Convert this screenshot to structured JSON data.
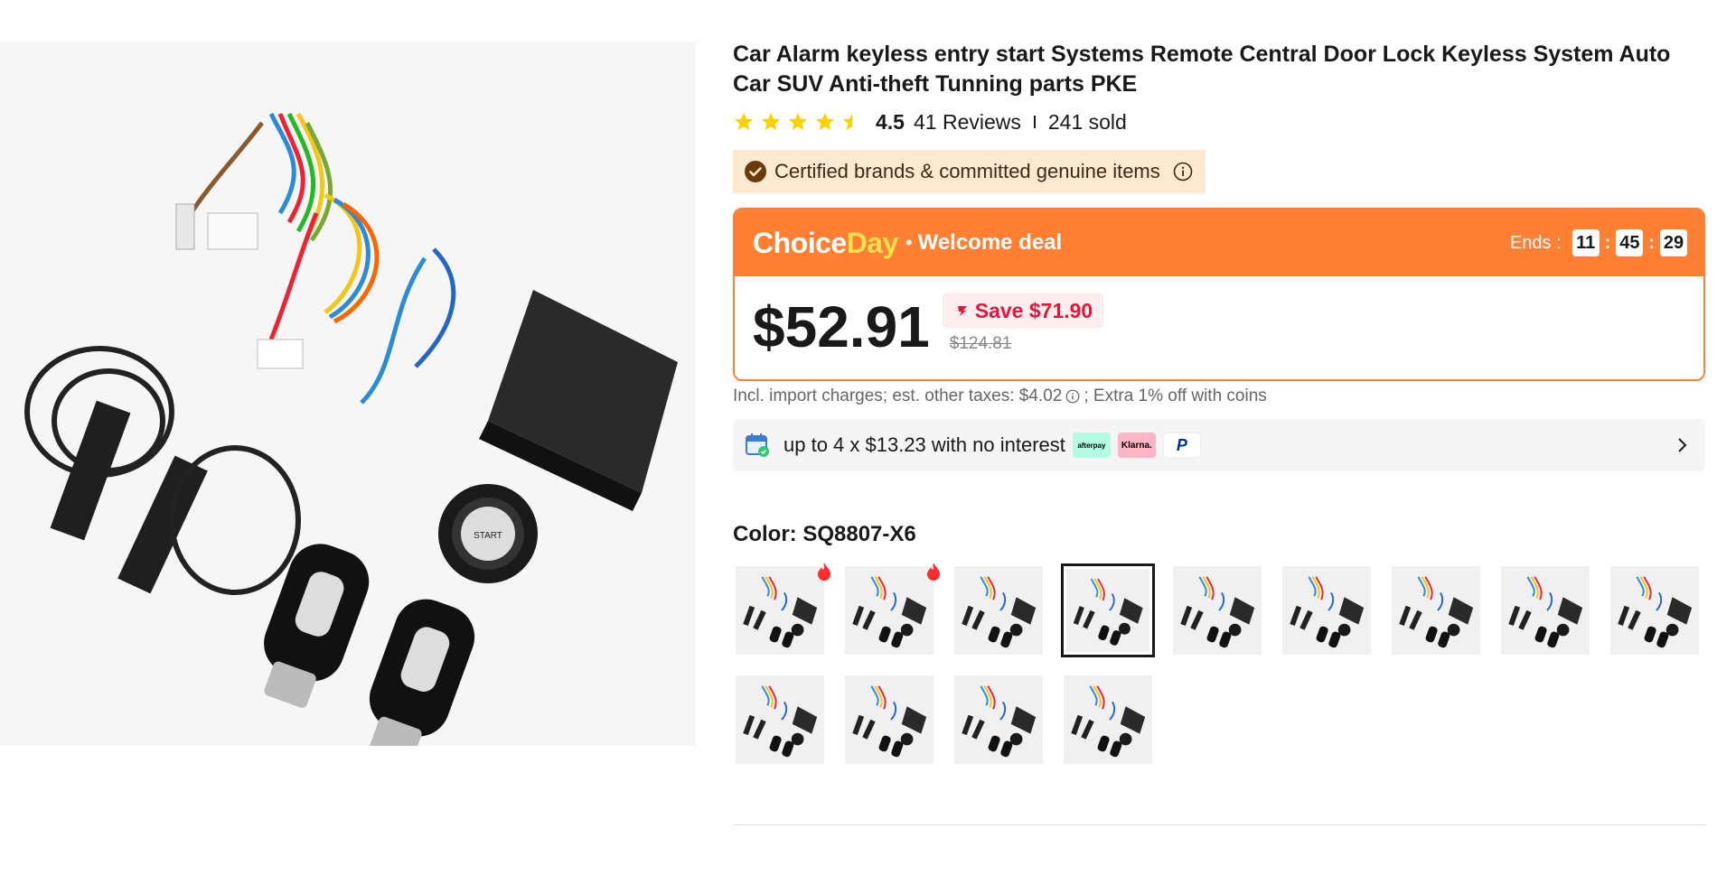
{
  "product": {
    "title": "Car Alarm keyless entry start Systems Remote Central Door Lock Keyless System Auto Car SUV Anti-theft Tunning parts PKE",
    "image_icon": "product-photo",
    "rating": "4.5",
    "stars_filled": 4.5,
    "reviews": "41 Reviews",
    "sold": "241 sold"
  },
  "certified": {
    "text": "Certified brands & committed genuine items",
    "icon": "check-shield-icon"
  },
  "deal": {
    "brand_part1": "Choice",
    "brand_part2": "Day",
    "dot": "•",
    "subtitle": "Welcome deal",
    "ends_label": "Ends :",
    "timer": {
      "hours": "11",
      "minutes": "45",
      "seconds": "29",
      "sep": ":"
    },
    "price": "$52.91",
    "save": "Save $71.90",
    "original_price": "$124.81",
    "accent": "#ff7f33",
    "save_color": "#e3173b"
  },
  "tax": {
    "text_before": "Incl. import charges; est. other taxes: $4.02",
    "text_after": "; Extra 1% off with coins"
  },
  "payment": {
    "text": "up to 4 x $13.23 with no interest",
    "logos": [
      "afterpay",
      "Klarna.",
      "P"
    ]
  },
  "color": {
    "label": "Color: SQ8807-X6",
    "selected_index": 3,
    "hot_indices": [
      0,
      1
    ],
    "swatch_count": 13
  }
}
